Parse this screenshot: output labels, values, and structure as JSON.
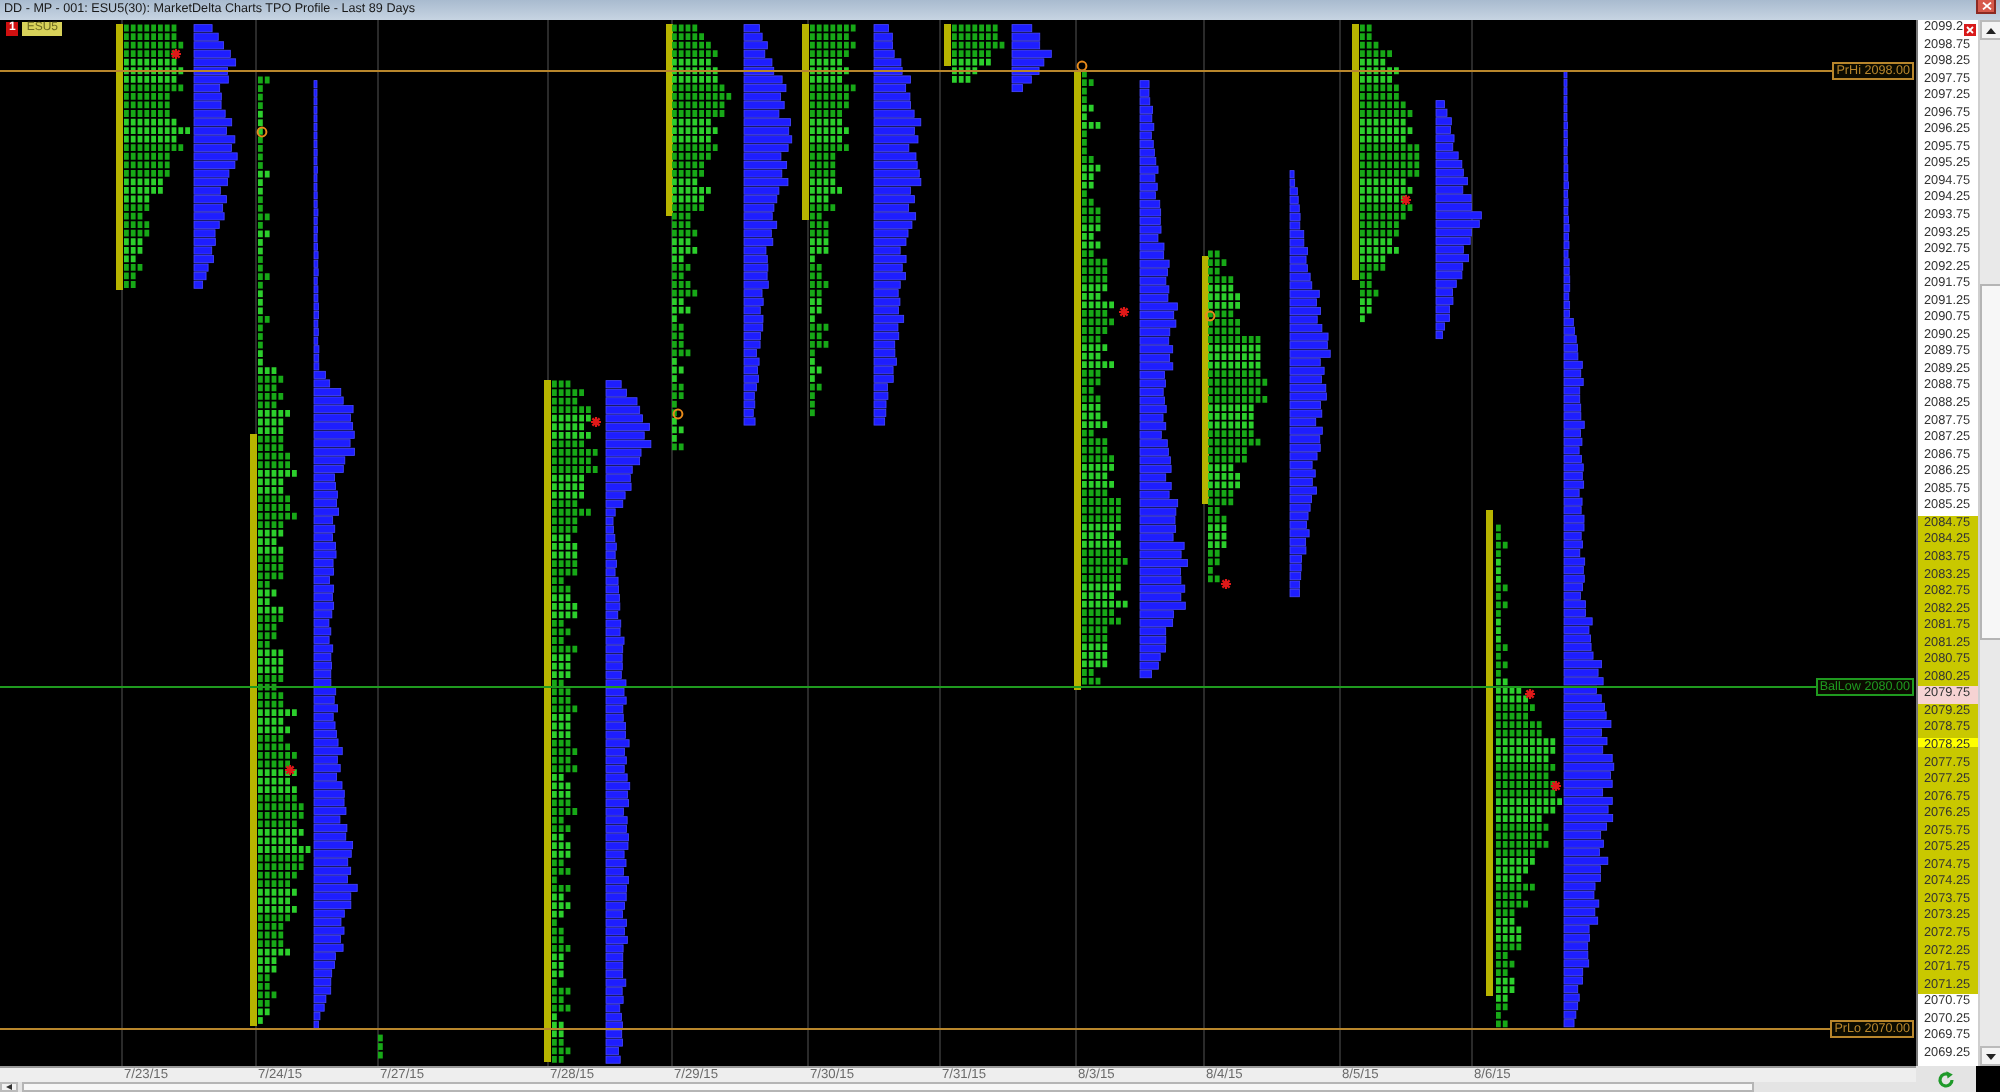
{
  "window": {
    "title": "DD - MP - 001: ESU5(30): MarketDelta Charts TPO Profile - Last 89 Days"
  },
  "chart": {
    "indicator": "1",
    "symbol": "ESU5",
    "reference_lines": [
      {
        "label": "PrHi 2098.00",
        "kind": "prior-high"
      },
      {
        "label": "BalLow 2080.00",
        "kind": "balance-low"
      },
      {
        "label": "PrLo 2070.00",
        "kind": "prior-low"
      }
    ],
    "dates": [
      "7/23/15",
      "7/24/15",
      "7/27/15",
      "7/28/15",
      "7/29/15",
      "7/30/15",
      "7/31/15",
      "8/3/15",
      "8/4/15",
      "8/5/15",
      "8/6/15"
    ]
  },
  "price_axis": {
    "labels": [
      {
        "text": "2099.2",
        "kind": "plain"
      },
      {
        "text": "2098.75",
        "kind": "plain"
      },
      {
        "text": "2098.25",
        "kind": "plain"
      },
      {
        "text": "2097.75",
        "kind": "plain"
      },
      {
        "text": "2097.25",
        "kind": "plain"
      },
      {
        "text": "2096.75",
        "kind": "plain"
      },
      {
        "text": "2096.25",
        "kind": "plain"
      },
      {
        "text": "2095.75",
        "kind": "plain"
      },
      {
        "text": "2095.25",
        "kind": "plain"
      },
      {
        "text": "2094.75",
        "kind": "plain"
      },
      {
        "text": "2094.25",
        "kind": "plain"
      },
      {
        "text": "2093.75",
        "kind": "plain"
      },
      {
        "text": "2093.25",
        "kind": "plain"
      },
      {
        "text": "2092.75",
        "kind": "plain"
      },
      {
        "text": "2092.25",
        "kind": "plain"
      },
      {
        "text": "2091.75",
        "kind": "plain"
      },
      {
        "text": "2091.25",
        "kind": "plain"
      },
      {
        "text": "2090.75",
        "kind": "plain"
      },
      {
        "text": "2090.25",
        "kind": "plain"
      },
      {
        "text": "2089.75",
        "kind": "plain"
      },
      {
        "text": "2089.25",
        "kind": "plain"
      },
      {
        "text": "2088.75",
        "kind": "plain"
      },
      {
        "text": "2088.25",
        "kind": "plain"
      },
      {
        "text": "2087.75",
        "kind": "plain"
      },
      {
        "text": "2087.25",
        "kind": "plain"
      },
      {
        "text": "2086.75",
        "kind": "plain"
      },
      {
        "text": "2086.25",
        "kind": "plain"
      },
      {
        "text": "2085.75",
        "kind": "plain"
      },
      {
        "text": "2085.25",
        "kind": "plain"
      },
      {
        "text": "2084.75",
        "kind": "range"
      },
      {
        "text": "2084.25",
        "kind": "range"
      },
      {
        "text": "2083.75",
        "kind": "range"
      },
      {
        "text": "2083.25",
        "kind": "range"
      },
      {
        "text": "2082.75",
        "kind": "range"
      },
      {
        "text": "2082.25",
        "kind": "range"
      },
      {
        "text": "2081.75",
        "kind": "range"
      },
      {
        "text": "2081.25",
        "kind": "range"
      },
      {
        "text": "2080.75",
        "kind": "range"
      },
      {
        "text": "2080.25",
        "kind": "range"
      },
      {
        "text": "2079.75",
        "kind": "last"
      },
      {
        "text": "2079.25",
        "kind": "range"
      },
      {
        "text": "2078.75",
        "kind": "range"
      },
      {
        "text": "2078.25",
        "kind": "poc"
      },
      {
        "text": "2077.75",
        "kind": "range"
      },
      {
        "text": "2077.25",
        "kind": "range"
      },
      {
        "text": "2076.75",
        "kind": "range"
      },
      {
        "text": "2076.25",
        "kind": "range"
      },
      {
        "text": "2075.75",
        "kind": "range"
      },
      {
        "text": "2075.25",
        "kind": "range"
      },
      {
        "text": "2074.75",
        "kind": "range"
      },
      {
        "text": "2074.25",
        "kind": "range"
      },
      {
        "text": "2073.75",
        "kind": "range"
      },
      {
        "text": "2073.25",
        "kind": "range"
      },
      {
        "text": "2072.75",
        "kind": "range"
      },
      {
        "text": "2072.25",
        "kind": "range"
      },
      {
        "text": "2071.75",
        "kind": "range"
      },
      {
        "text": "2071.25",
        "kind": "range"
      },
      {
        "text": "2070.75",
        "kind": "plain"
      },
      {
        "text": "2070.25",
        "kind": "plain"
      },
      {
        "text": "2069.75",
        "kind": "plain"
      },
      {
        "text": "2069.25",
        "kind": "plain"
      }
    ]
  }
}
